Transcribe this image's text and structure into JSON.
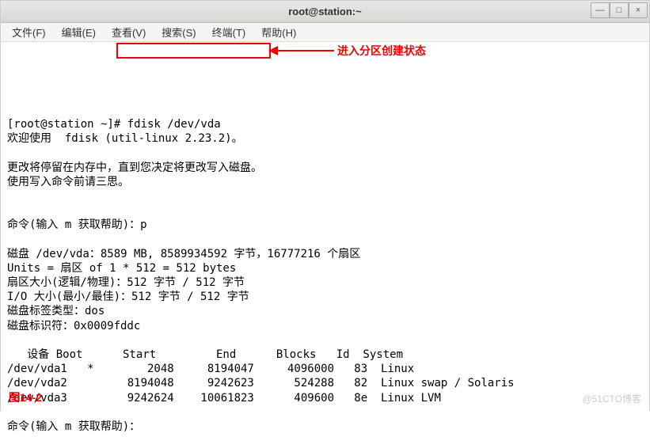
{
  "window": {
    "title": "root@station:~",
    "minimize": "—",
    "maximize": "□",
    "close": "×"
  },
  "menu": {
    "file": "文件(F)",
    "edit": "编辑(E)",
    "view": "查看(V)",
    "search": "搜索(S)",
    "terminal": "终端(T)",
    "help": "帮助(H)"
  },
  "terminal": {
    "line1": "[root@station ~]# fdisk /dev/vda",
    "line2": "欢迎使用  fdisk (util-linux 2.23.2)。",
    "line3": "",
    "line4": "更改将停留在内存中，直到您决定将更改写入磁盘。",
    "line5": "使用写入命令前请三思。",
    "line6": "",
    "line7": "",
    "line8": "命令(输入 m 获取帮助)：p",
    "line9": "",
    "line10": "磁盘 /dev/vda：8589 MB, 8589934592 字节，16777216 个扇区",
    "line11": "Units = 扇区 of 1 * 512 = 512 bytes",
    "line12": "扇区大小(逻辑/物理)：512 字节 / 512 字节",
    "line13": "I/O 大小(最小/最佳)：512 字节 / 512 字节",
    "line14": "磁盘标签类型：dos",
    "line15": "磁盘标识符：0x0009fddc",
    "line16": "",
    "header": "   设备 Boot      Start         End      Blocks   Id  System",
    "row1": "/dev/vda1   *        2048     8194047     4096000   83  Linux",
    "row2": "/dev/vda2         8194048     9242623      524288   82  Linux swap / Solaris",
    "row3": "/dev/vda3         9242624    10061823      409600   8e  Linux LVM",
    "line21": "",
    "line22": "命令(输入 m 获取帮助)："
  },
  "annotation": "进入分区创建状态",
  "figure_label": "图14-2",
  "watermark": "@51CTO博客"
}
